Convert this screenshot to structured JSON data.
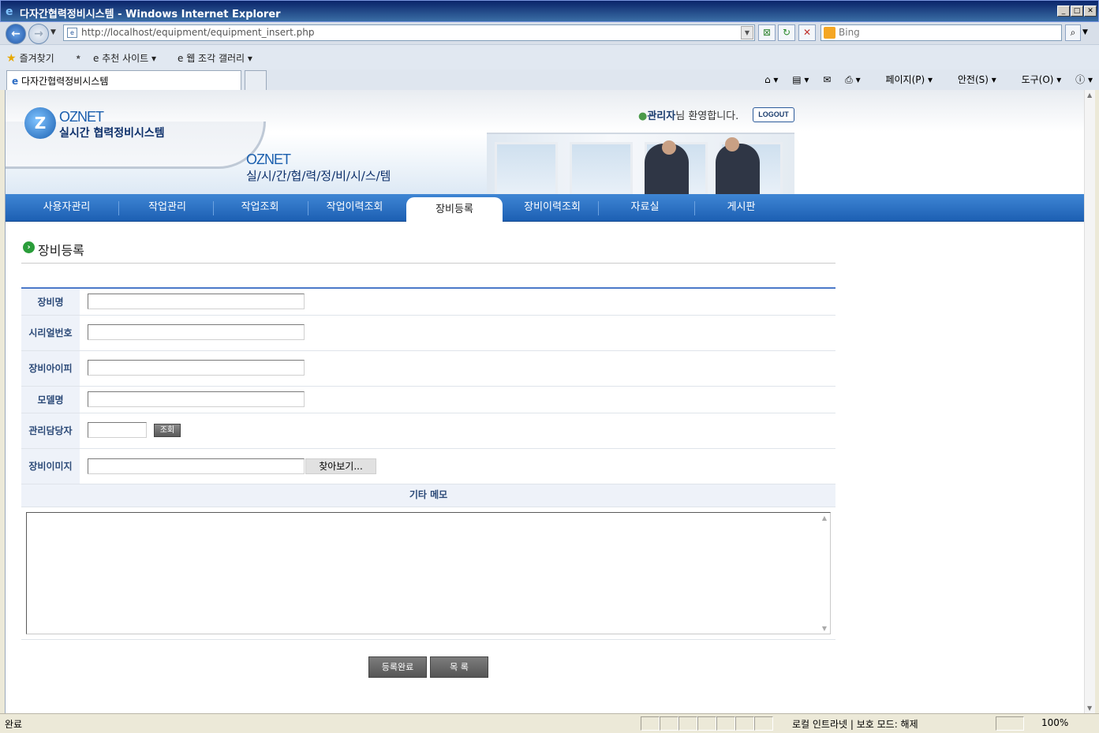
{
  "window": {
    "title": "다자간협력정비시스템 - Windows Internet Explorer"
  },
  "browser": {
    "url": "http://localhost/equipment/equipment_insert.php",
    "search_placeholder": "Bing",
    "favorites_label": "즐겨찾기",
    "suggested_sites": "추천 사이트",
    "web_slice_gallery": "웹 조각 갤러리",
    "tab_title": "다자간협력정비시스템",
    "cmd": {
      "page": "페이지(P)",
      "safety": "안전(S)",
      "tools": "도구(O)"
    }
  },
  "header": {
    "brand": "OZNET",
    "brand_sub": "실시간 협력정비시스템",
    "slogan_brand": "OZNET",
    "slogan": "실/시/간/협/력/정/비/시/스/템",
    "welcome_user": "관리자",
    "welcome_suffix": "님 환영합니다.",
    "logout": "LOGOUT"
  },
  "menu": {
    "items": [
      "사용자관리",
      "작업관리",
      "작업조회",
      "작업이력조회",
      "장비등록",
      "장비이력조회",
      "자료실",
      "게시판"
    ],
    "active_index": 4
  },
  "page": {
    "title": "장비등록"
  },
  "form": {
    "labels": {
      "name": "장비명",
      "serial": "시리얼번호",
      "ip": "장비아이피",
      "model": "모델명",
      "manager": "관리담당자",
      "image": "장비이미지"
    },
    "lookup_button": "조회",
    "browse_button": "찾아보기...",
    "memo_header": "기타 메모",
    "submit_button": "등록완료",
    "list_button": "목 록"
  },
  "status": {
    "text": "완료",
    "zone": "로컬 인트라넷 | 보호 모드: 해제",
    "zoom": "100%"
  },
  "colors": {
    "menu": "#1c5fb3",
    "accent": "#4b79c9",
    "label_bg": "#eef2f9"
  }
}
